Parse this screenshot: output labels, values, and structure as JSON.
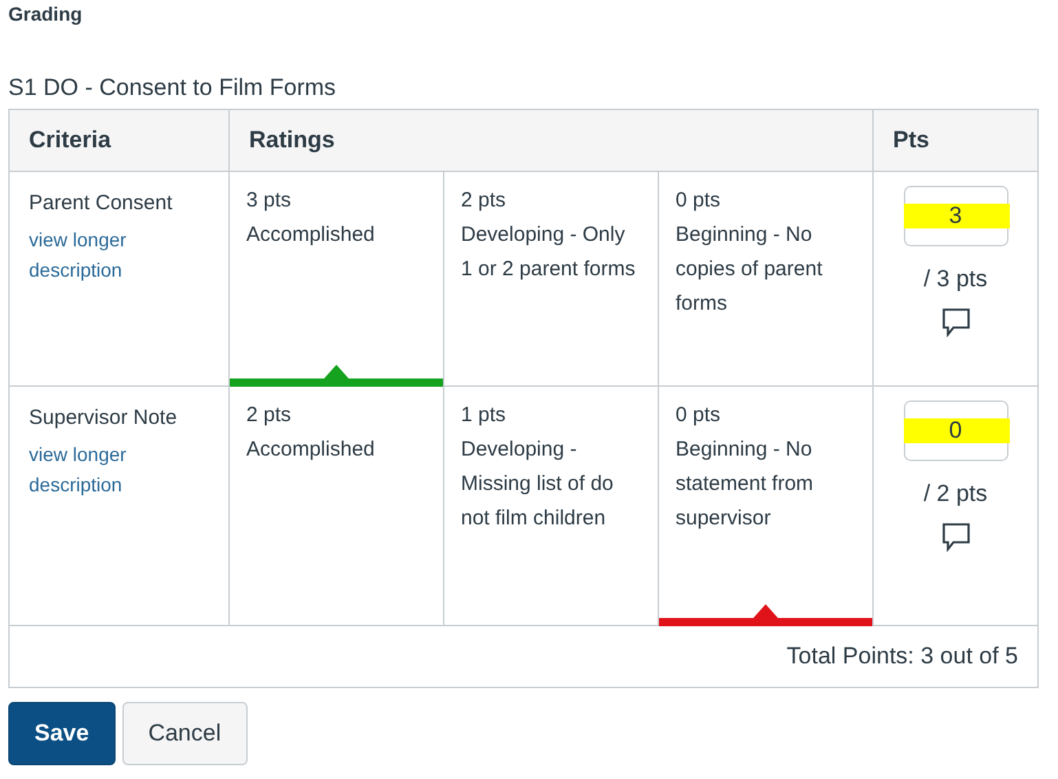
{
  "heading": "Grading",
  "rubric": {
    "title": "S1 DO - Consent to Film Forms",
    "columns": [
      "Criteria",
      "Ratings",
      "Pts"
    ],
    "criteria": [
      {
        "name": "Parent Consent",
        "link": "view longer description",
        "color": "#14a21f",
        "points": "3",
        "highlighted": true,
        "out_of": "/ 3 pts",
        "ratings": [
          {
            "points": "3 pts",
            "description": "Accomplished",
            "selected": true
          },
          {
            "points": "2 pts",
            "description": "Developing - Only 1 or 2 parent forms",
            "selected": false
          },
          {
            "points": "0 pts",
            "description": "Beginning - No copies of parent forms",
            "selected": false
          }
        ]
      },
      {
        "name": "Supervisor Note",
        "link": "view longer description",
        "color": "#e0131b",
        "points": "0",
        "highlighted": true,
        "out_of": "/ 2 pts",
        "ratings": [
          {
            "points": "2 pts",
            "description": "Accomplished",
            "selected": false
          },
          {
            "points": "1 pts",
            "description": "Developing - Missing list of do not film children",
            "selected": false
          },
          {
            "points": "0 pts",
            "description": "Beginning - No statement from supervisor",
            "selected": true
          }
        ]
      }
    ],
    "total": "Total Points: 3 out of 5"
  },
  "buttons": [
    {
      "label": "Save",
      "kind": "primary"
    },
    {
      "label": "Cancel",
      "kind": "secondary"
    }
  ]
}
